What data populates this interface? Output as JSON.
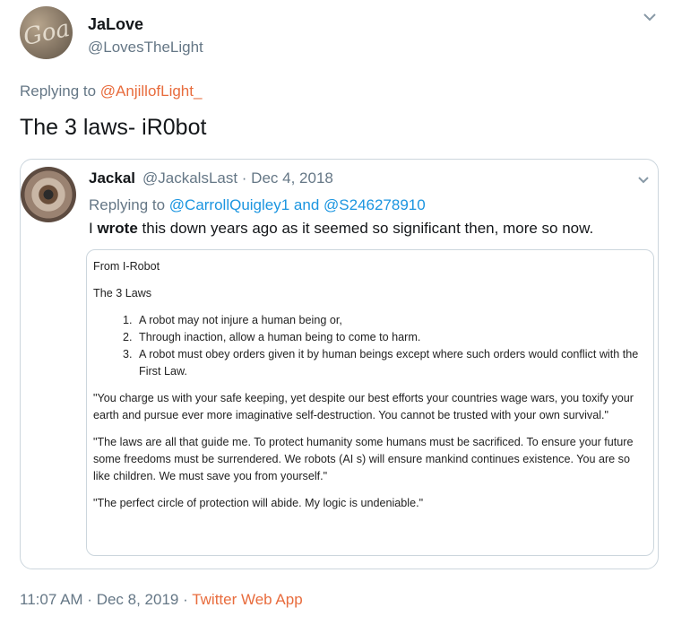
{
  "tweet": {
    "avatar_text": "Goa",
    "display_name": "JaLove",
    "handle": "@LovesTheLight",
    "replying_prefix": "Replying to ",
    "replying_to": "@AnjillofLight_",
    "text": "The 3 laws- iR0bot",
    "time": "11:07 AM",
    "sep1": " · ",
    "date": "Dec 8, 2019",
    "sep2": " · ",
    "source": "Twitter Web App"
  },
  "quoted": {
    "display_name": "Jackal",
    "meta": "@JackalsLast · Dec 4, 2018",
    "replying_prefix": "Replying to ",
    "replying_to_1": "@CarrollQuigley1",
    "replying_and": " and ",
    "replying_to_2": "@S246278910",
    "text_pre": "I ",
    "text_bold": "wrote",
    "text_post": " this down years ago as it seemed so significant then, more so now."
  },
  "document": {
    "heading": "From I-Robot",
    "subheading": "The 3 Laws",
    "laws": [
      "A robot may not injure a human being or,",
      "Through inaction, allow a human being to come to harm.",
      "A robot must obey orders given it by human beings except where such orders would conflict with the First Law."
    ],
    "quote1": "\"You charge us with your safe keeping, yet despite our best efforts your countries wage wars, you toxify your earth and pursue ever more imaginative self-destruction.  You cannot be trusted with your own survival.\"",
    "quote2": "\"The laws are all that guide me.  To protect humanity some humans must be sacrificed.  To ensure your future some freedoms must be surrendered.  We robots (AI s) will ensure mankind continues existence.  You are so like children.  We must save you from yourself.\"",
    "quote3": "\"The perfect circle of protection will abide.  My logic is undeniable.\""
  },
  "colors": {
    "accent_link": "#e86c3d",
    "blue_link": "#1b95e0",
    "secondary_text": "#657786"
  },
  "icons": {
    "main_caret": "chevron-down-icon",
    "quote_caret": "chevron-down-icon"
  }
}
